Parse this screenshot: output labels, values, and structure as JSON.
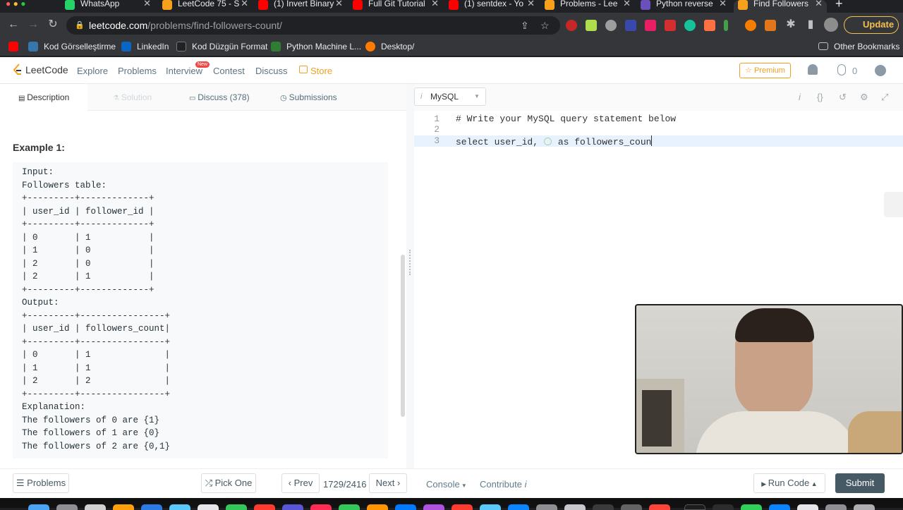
{
  "browser": {
    "tabs": [
      {
        "label": "WhatsApp",
        "color": "#25d366"
      },
      {
        "label": "LeetCode 75 - S",
        "color": "#f89f1b"
      },
      {
        "label": "(1) Invert Binary",
        "color": "#ff0000"
      },
      {
        "label": "Full Git Tutorial",
        "color": "#ff0000"
      },
      {
        "label": "(1) sentdex - Yo",
        "color": "#ff0000"
      },
      {
        "label": "Problems - Lee",
        "color": "#f89f1b"
      },
      {
        "label": "Python reverse",
        "color": "#6b4fbb"
      },
      {
        "label": "Find Followers",
        "color": "#f89f1b"
      }
    ],
    "url_domain": "leetcode.com",
    "url_path": "/problems/find-followers-count/",
    "update_label": "Update",
    "bookmarks": [
      {
        "label": "Kod Görselleştirme",
        "color": "#ff0000"
      },
      {
        "label": "LinkedIn",
        "color": "#0a66c2"
      },
      {
        "label": "Kod Düzgün Format",
        "color": "#333333"
      },
      {
        "label": "Python Machine L...",
        "color": "#2e7d32"
      },
      {
        "label": "Desktop/",
        "color": "#ff7a00"
      }
    ],
    "other_bookmarks": "Other Bookmarks"
  },
  "leetcode_nav": {
    "logo": "LeetCode",
    "links": [
      "Explore",
      "Problems",
      "Interview",
      "Contest",
      "Discuss",
      "Store"
    ],
    "new_badge": "New",
    "premium": "Premium",
    "coins": "0"
  },
  "left_tabs": [
    "Description",
    "Solution",
    "Discuss (378)",
    "Submissions"
  ],
  "example": {
    "title": "Example 1:",
    "content": "Input:\nFollowers table:\n+---------+-------------+\n| user_id | follower_id |\n+---------+-------------+\n| 0       | 1           |\n| 1       | 0           |\n| 2       | 0           |\n| 2       | 1           |\n+---------+-------------+\nOutput:\n+---------+----------------+\n| user_id | followers_count|\n+---------+----------------+\n| 0       | 1              |\n| 1       | 1              |\n| 2       | 2              |\n+---------+----------------+\nExplanation:\nThe followers of 0 are {1}\nThe followers of 1 are {0}\nThe followers of 2 are {0,1}"
  },
  "editor": {
    "language": "MySQL",
    "lines": [
      {
        "num": "1",
        "text": "# Write your MySQL query statement below"
      },
      {
        "num": "2",
        "text": ""
      },
      {
        "num": "3",
        "text_before": "select user_id, ",
        "text_after": "as followers_coun"
      }
    ]
  },
  "bottom": {
    "problems": "Problems",
    "pick_one": "Pick One",
    "prev": "Prev",
    "counter": "1729/2416",
    "next": "Next",
    "console": "Console",
    "contribute": "Contribute",
    "run_code": "Run Code",
    "submit": "Submit"
  }
}
